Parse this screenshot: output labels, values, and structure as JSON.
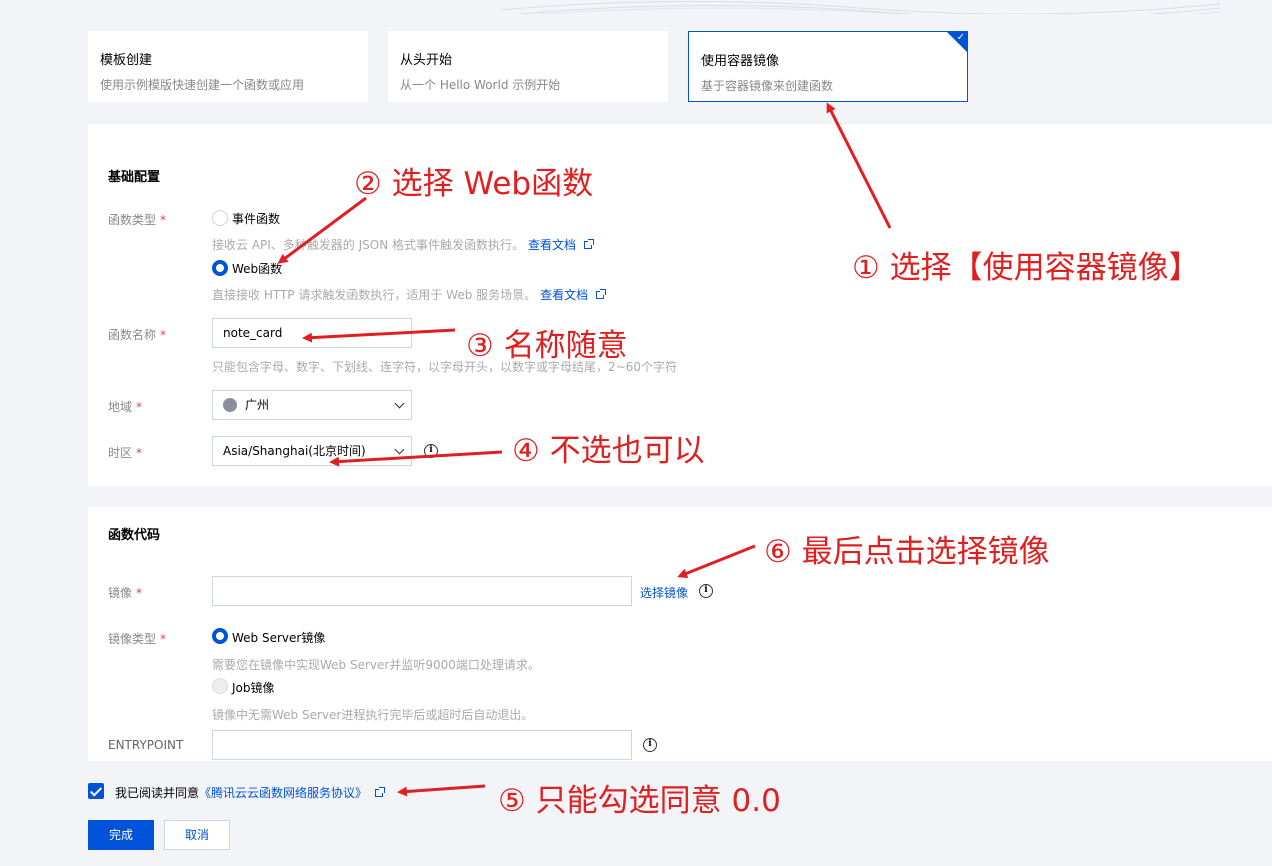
{
  "cards": [
    {
      "title": "模板创建",
      "desc": "使用示例模版快速创建一个函数或应用"
    },
    {
      "title": "从头开始",
      "desc": "从一个 Hello World 示例开始"
    },
    {
      "title": "使用容器镜像",
      "desc": "基于容器镜像来创建函数"
    }
  ],
  "basic": {
    "title": "基础配置",
    "func_type_label": "函数类型",
    "event_label": "事件函数",
    "event_hint": "接收云 API、多种触发器的 JSON 格式事件触发函数执行。",
    "web_label": "Web函数",
    "web_hint": "直接接收 HTTP 请求触发函数执行，适用于 Web 服务场景。",
    "doc_link": "查看文档",
    "name_label": "函数名称",
    "name_value": "note_card",
    "name_hint": "只能包含字母、数字、下划线、连字符，以字母开头，以数字或字母结尾，2~60个字符",
    "region_label": "地域",
    "region_value": "广州",
    "tz_label": "时区",
    "tz_value": "Asia/Shanghai(北京时间)"
  },
  "code": {
    "title": "函数代码",
    "image_label": "镜像",
    "select_image": "选择镜像",
    "image_type_label": "镜像类型",
    "webserver_label": "Web Server镜像",
    "webserver_hint": "需要您在镜像中实现Web Server并监听9000端口处理请求。",
    "job_label": "Job镜像",
    "job_hint": "镜像中无需Web Server进程执行完毕后或超时后自动退出。",
    "entrypoint_label": "ENTRYPOINT"
  },
  "agreement": {
    "prefix": "我已阅读并同意",
    "link": "《腾讯云云函数网络服务协议》"
  },
  "buttons": {
    "done": "完成",
    "cancel": "取消"
  },
  "required_mark": "*",
  "annotations": {
    "a1": "① 选择【使用容器镜像】",
    "a2": "② 选择 Web函数",
    "a3": "③ 名称随意",
    "a4": "④ 不选也可以",
    "a5": "⑤ 只能勾选同意 0.0",
    "a6": "⑥ 最后点击选择镜像"
  },
  "colors": {
    "accent": "#0052d9",
    "annotation": "#e02020",
    "required": "#e54545"
  }
}
